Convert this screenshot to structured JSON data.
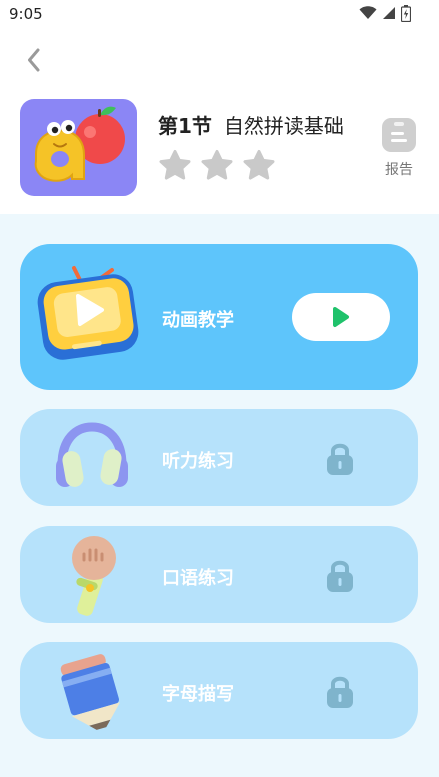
{
  "status_bar": {
    "time": "9:05"
  },
  "lesson": {
    "number": "第1节",
    "name": "自然拼读基础",
    "stars_earned": 0,
    "stars_total": 3
  },
  "report": {
    "label": "报告"
  },
  "modules": [
    {
      "label": "动画教学",
      "locked": false
    },
    {
      "label": "听力练习",
      "locked": true
    },
    {
      "label": "口语练习",
      "locked": true
    },
    {
      "label": "字母描写",
      "locked": true
    }
  ],
  "colors": {
    "primary_card": "#5ec5fb",
    "locked_card": "#b6e2fb",
    "play_green": "#1fc26b",
    "star_gray": "#c9c9c9"
  }
}
